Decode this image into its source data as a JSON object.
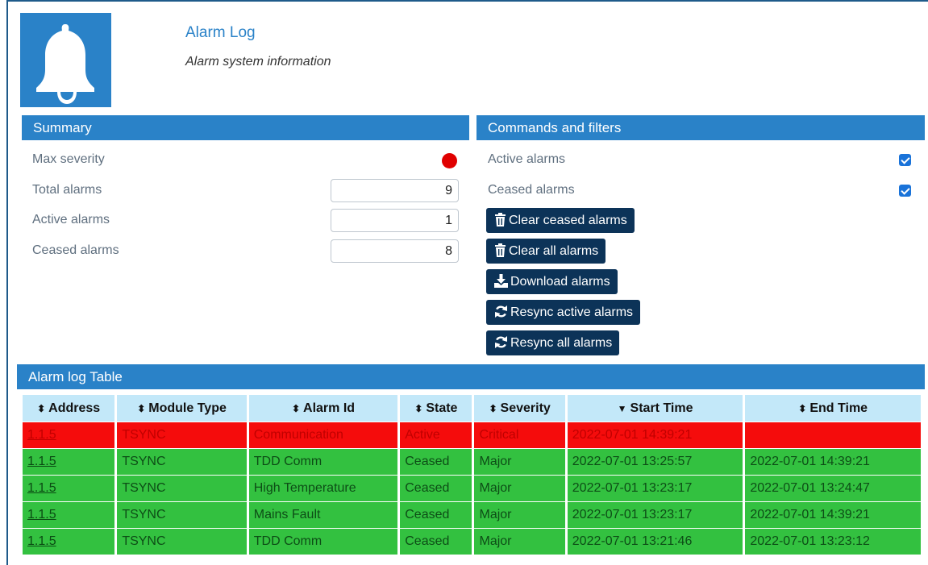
{
  "header": {
    "logo_icon": "bell-icon",
    "title": "Alarm Log",
    "subtitle": "Alarm system information"
  },
  "summary": {
    "heading": "Summary",
    "max_severity_label": "Max severity",
    "max_severity_color": "#e00000",
    "total_label": "Total alarms",
    "total_value": "9",
    "active_label": "Active alarms",
    "active_value": "1",
    "ceased_label": "Ceased alarms",
    "ceased_value": "8"
  },
  "commands": {
    "heading": "Commands and filters",
    "filter_active_label": "Active alarms",
    "filter_active_checked": true,
    "filter_ceased_label": "Ceased alarms",
    "filter_ceased_checked": true,
    "clear_ceased": "Clear ceased alarms",
    "clear_all": "Clear all alarms",
    "download": "Download alarms",
    "resync_active": "Resync active alarms",
    "resync_all": "Resync all alarms"
  },
  "table": {
    "heading": "Alarm log Table",
    "columns": [
      {
        "label": "Address",
        "sort": "both"
      },
      {
        "label": "Module Type",
        "sort": "both"
      },
      {
        "label": "Alarm Id",
        "sort": "both"
      },
      {
        "label": "State",
        "sort": "both"
      },
      {
        "label": "Severity",
        "sort": "both"
      },
      {
        "label": "Start Time",
        "sort": "desc"
      },
      {
        "label": "End Time",
        "sort": "both"
      }
    ],
    "rows": [
      {
        "address": "1.1.5",
        "module": "TSYNC",
        "alarm_id": "Communication",
        "state": "Active",
        "severity": "Critical",
        "start": "2022-07-01 14:39:21",
        "end": ""
      },
      {
        "address": "1.1.5",
        "module": "TSYNC",
        "alarm_id": "TDD Comm",
        "state": "Ceased",
        "severity": "Major",
        "start": "2022-07-01 13:25:57",
        "end": "2022-07-01 14:39:21"
      },
      {
        "address": "1.1.5",
        "module": "TSYNC",
        "alarm_id": "High Temperature",
        "state": "Ceased",
        "severity": "Major",
        "start": "2022-07-01 13:23:17",
        "end": "2022-07-01 13:24:47"
      },
      {
        "address": "1.1.5",
        "module": "TSYNC",
        "alarm_id": "Mains Fault",
        "state": "Ceased",
        "severity": "Major",
        "start": "2022-07-01 13:23:17",
        "end": "2022-07-01 14:39:21"
      },
      {
        "address": "1.1.5",
        "module": "TSYNC",
        "alarm_id": "TDD Comm",
        "state": "Ceased",
        "severity": "Major",
        "start": "2022-07-01 13:21:46",
        "end": "2022-07-01 13:23:12"
      }
    ]
  },
  "colors": {
    "accent": "#2a82c8",
    "button": "#0c3358",
    "active_row": "#f50c0c",
    "ceased_row": "#33c140",
    "header_row": "#c3e8f9"
  }
}
